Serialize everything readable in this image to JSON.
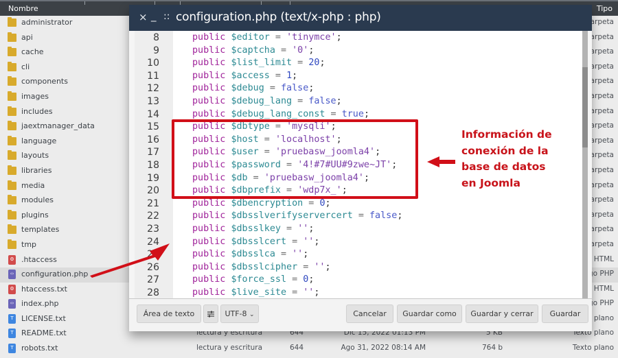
{
  "file_manager": {
    "columns": {
      "name": "Nombre",
      "type": "Tipo"
    },
    "rows": [
      {
        "name": "administrator",
        "icon": "folder-icon",
        "type": "Carpeta"
      },
      {
        "name": "api",
        "icon": "folder-icon",
        "type": "Carpeta"
      },
      {
        "name": "cache",
        "icon": "folder-icon",
        "type": "Carpeta"
      },
      {
        "name": "cli",
        "icon": "folder-icon",
        "type": "Carpeta"
      },
      {
        "name": "components",
        "icon": "folder-icon",
        "type": "Carpeta"
      },
      {
        "name": "images",
        "icon": "folder-icon",
        "type": "Carpeta"
      },
      {
        "name": "includes",
        "icon": "folder-icon",
        "type": "Carpeta"
      },
      {
        "name": "jaextmanager_data",
        "icon": "folder-icon",
        "type": "Carpeta"
      },
      {
        "name": "language",
        "icon": "folder-icon",
        "type": "Carpeta"
      },
      {
        "name": "layouts",
        "icon": "folder-icon",
        "type": "Carpeta"
      },
      {
        "name": "libraries",
        "icon": "folder-icon",
        "type": "Carpeta"
      },
      {
        "name": "media",
        "icon": "folder-icon",
        "type": "Carpeta"
      },
      {
        "name": "modules",
        "icon": "folder-icon",
        "type": "Carpeta"
      },
      {
        "name": "plugins",
        "icon": "folder-icon",
        "type": "Carpeta"
      },
      {
        "name": "templates",
        "icon": "folder-icon",
        "type": "Carpeta"
      },
      {
        "name": "tmp",
        "icon": "folder-icon",
        "type": "Carpeta"
      },
      {
        "name": ".htaccess",
        "icon": "htaccess-file-icon",
        "type": "HTML"
      },
      {
        "name": "configuration.php",
        "icon": "php-file-icon",
        "type": "Código PHP",
        "selected": true
      },
      {
        "name": "htaccess.txt",
        "icon": "htaccess-file-icon",
        "type": "HTML"
      },
      {
        "name": "index.php",
        "icon": "php-file-icon",
        "type": "Código PHP"
      },
      {
        "name": "LICENSE.txt",
        "icon": "text-file-icon",
        "type": "Texto plano"
      },
      {
        "name": "README.txt",
        "icon": "text-file-icon",
        "permissions": "lectura y escritura",
        "octal": "644",
        "modified": "Dic 15, 2022 01:13 PM",
        "size": "5 KB",
        "type": "Texto plano"
      },
      {
        "name": "robots.txt",
        "icon": "text-file-icon",
        "permissions": "lectura y escritura",
        "octal": "644",
        "modified": "Ago 31, 2022 08:14 AM",
        "size": "764 b",
        "type": "Texto plano"
      }
    ]
  },
  "editor": {
    "title": "configuration.php (text/x-php : php)",
    "close_glyph": "×",
    "minimize_glyph": "_",
    "drag_glyph": "::",
    "lines": [
      {
        "n": "8",
        "tokens": [
          [
            "kw",
            "public"
          ],
          [
            "sp",
            " "
          ],
          [
            "var",
            "$editor"
          ],
          [
            "op",
            " = "
          ],
          [
            "str",
            "'tinymce'"
          ],
          [
            "punc",
            ";"
          ]
        ]
      },
      {
        "n": "9",
        "tokens": [
          [
            "kw",
            "public"
          ],
          [
            "sp",
            " "
          ],
          [
            "var",
            "$captcha"
          ],
          [
            "op",
            " = "
          ],
          [
            "str",
            "'0'"
          ],
          [
            "punc",
            ";"
          ]
        ]
      },
      {
        "n": "10",
        "tokens": [
          [
            "kw",
            "public"
          ],
          [
            "sp",
            " "
          ],
          [
            "var",
            "$list_limit"
          ],
          [
            "op",
            " = "
          ],
          [
            "num",
            "20"
          ],
          [
            "punc",
            ";"
          ]
        ]
      },
      {
        "n": "11",
        "tokens": [
          [
            "kw",
            "public"
          ],
          [
            "sp",
            " "
          ],
          [
            "var",
            "$access"
          ],
          [
            "op",
            " = "
          ],
          [
            "num",
            "1"
          ],
          [
            "punc",
            ";"
          ]
        ]
      },
      {
        "n": "12",
        "tokens": [
          [
            "kw",
            "public"
          ],
          [
            "sp",
            " "
          ],
          [
            "var",
            "$debug"
          ],
          [
            "op",
            " = "
          ],
          [
            "atom",
            "false"
          ],
          [
            "punc",
            ";"
          ]
        ]
      },
      {
        "n": "13",
        "tokens": [
          [
            "kw",
            "public"
          ],
          [
            "sp",
            " "
          ],
          [
            "var",
            "$debug_lang"
          ],
          [
            "op",
            " = "
          ],
          [
            "atom",
            "false"
          ],
          [
            "punc",
            ";"
          ]
        ]
      },
      {
        "n": "14",
        "tokens": [
          [
            "kw",
            "public"
          ],
          [
            "sp",
            " "
          ],
          [
            "var",
            "$debug_lang_const"
          ],
          [
            "op",
            " = "
          ],
          [
            "atom",
            "true"
          ],
          [
            "punc",
            ";"
          ]
        ]
      },
      {
        "n": "15",
        "tokens": [
          [
            "kw",
            "public"
          ],
          [
            "sp",
            " "
          ],
          [
            "var",
            "$dbtype"
          ],
          [
            "op",
            " = "
          ],
          [
            "str",
            "'mysqli'"
          ],
          [
            "punc",
            ";"
          ]
        ]
      },
      {
        "n": "16",
        "tokens": [
          [
            "kw",
            "public"
          ],
          [
            "sp",
            " "
          ],
          [
            "var",
            "$host"
          ],
          [
            "op",
            " = "
          ],
          [
            "str",
            "'localhost'"
          ],
          [
            "punc",
            ";"
          ]
        ]
      },
      {
        "n": "17",
        "tokens": [
          [
            "kw",
            "public"
          ],
          [
            "sp",
            " "
          ],
          [
            "var",
            "$user"
          ],
          [
            "op",
            " = "
          ],
          [
            "str",
            "'pruebasw_joomla4'"
          ],
          [
            "punc",
            ";"
          ]
        ]
      },
      {
        "n": "18",
        "tokens": [
          [
            "kw",
            "public"
          ],
          [
            "sp",
            " "
          ],
          [
            "var",
            "$password"
          ],
          [
            "op",
            " = "
          ],
          [
            "str",
            "'4!#7#UU#9zwe~JT'"
          ],
          [
            "punc",
            ";"
          ]
        ]
      },
      {
        "n": "19",
        "tokens": [
          [
            "kw",
            "public"
          ],
          [
            "sp",
            " "
          ],
          [
            "var",
            "$db"
          ],
          [
            "op",
            " = "
          ],
          [
            "str",
            "'pruebasw_joomla4'"
          ],
          [
            "punc",
            ";"
          ]
        ]
      },
      {
        "n": "20",
        "tokens": [
          [
            "kw",
            "public"
          ],
          [
            "sp",
            " "
          ],
          [
            "var",
            "$dbprefix"
          ],
          [
            "op",
            " = "
          ],
          [
            "str",
            "'wdp7x_'"
          ],
          [
            "punc",
            ";"
          ]
        ]
      },
      {
        "n": "21",
        "tokens": [
          [
            "kw",
            "public"
          ],
          [
            "sp",
            " "
          ],
          [
            "var",
            "$dbencryption"
          ],
          [
            "op",
            " = "
          ],
          [
            "num",
            "0"
          ],
          [
            "punc",
            ";"
          ]
        ]
      },
      {
        "n": "22",
        "tokens": [
          [
            "kw",
            "public"
          ],
          [
            "sp",
            " "
          ],
          [
            "var",
            "$dbsslverifyservercert"
          ],
          [
            "op",
            " = "
          ],
          [
            "atom",
            "false"
          ],
          [
            "punc",
            ";"
          ]
        ]
      },
      {
        "n": "23",
        "tokens": [
          [
            "kw",
            "public"
          ],
          [
            "sp",
            " "
          ],
          [
            "var",
            "$dbsslkey"
          ],
          [
            "op",
            " = "
          ],
          [
            "str",
            "''"
          ],
          [
            "punc",
            ";"
          ]
        ]
      },
      {
        "n": "24",
        "tokens": [
          [
            "kw",
            "public"
          ],
          [
            "sp",
            " "
          ],
          [
            "var",
            "$dbsslcert"
          ],
          [
            "op",
            " = "
          ],
          [
            "str",
            "''"
          ],
          [
            "punc",
            ";"
          ]
        ]
      },
      {
        "n": "25",
        "tokens": [
          [
            "kw",
            "public"
          ],
          [
            "sp",
            " "
          ],
          [
            "var",
            "$dbsslca"
          ],
          [
            "op",
            " = "
          ],
          [
            "str",
            "''"
          ],
          [
            "punc",
            ";"
          ]
        ]
      },
      {
        "n": "26",
        "tokens": [
          [
            "kw",
            "public"
          ],
          [
            "sp",
            " "
          ],
          [
            "var",
            "$dbsslcipher"
          ],
          [
            "op",
            " = "
          ],
          [
            "str",
            "''"
          ],
          [
            "punc",
            ";"
          ]
        ]
      },
      {
        "n": "27",
        "tokens": [
          [
            "kw",
            "public"
          ],
          [
            "sp",
            " "
          ],
          [
            "var",
            "$force_ssl"
          ],
          [
            "op",
            " = "
          ],
          [
            "num",
            "0"
          ],
          [
            "punc",
            ";"
          ]
        ]
      },
      {
        "n": "28",
        "tokens": [
          [
            "kw",
            "public"
          ],
          [
            "sp",
            " "
          ],
          [
            "var",
            "$live_site"
          ],
          [
            "op",
            " = "
          ],
          [
            "str",
            "''"
          ],
          [
            "punc",
            ";"
          ]
        ]
      }
    ],
    "footer": {
      "textarea_button": "Área de texto",
      "settings_icon": "sliders-icon",
      "encoding": "UTF-8",
      "encoding_chevron": "⌄",
      "cancel": "Cancelar",
      "save_as": "Guardar como",
      "save_close": "Guardar y cerrar",
      "save": "Guardar"
    }
  },
  "annotation": {
    "lines": [
      "Información de",
      "conexión de la",
      "base de datos",
      "en Joomla"
    ],
    "color": "#c8131a"
  },
  "colors": {
    "title_bar": "#2a3a4f",
    "header_bar": "#3c4146",
    "folder": "#d8aa2c",
    "highlight": "#d10f18"
  }
}
